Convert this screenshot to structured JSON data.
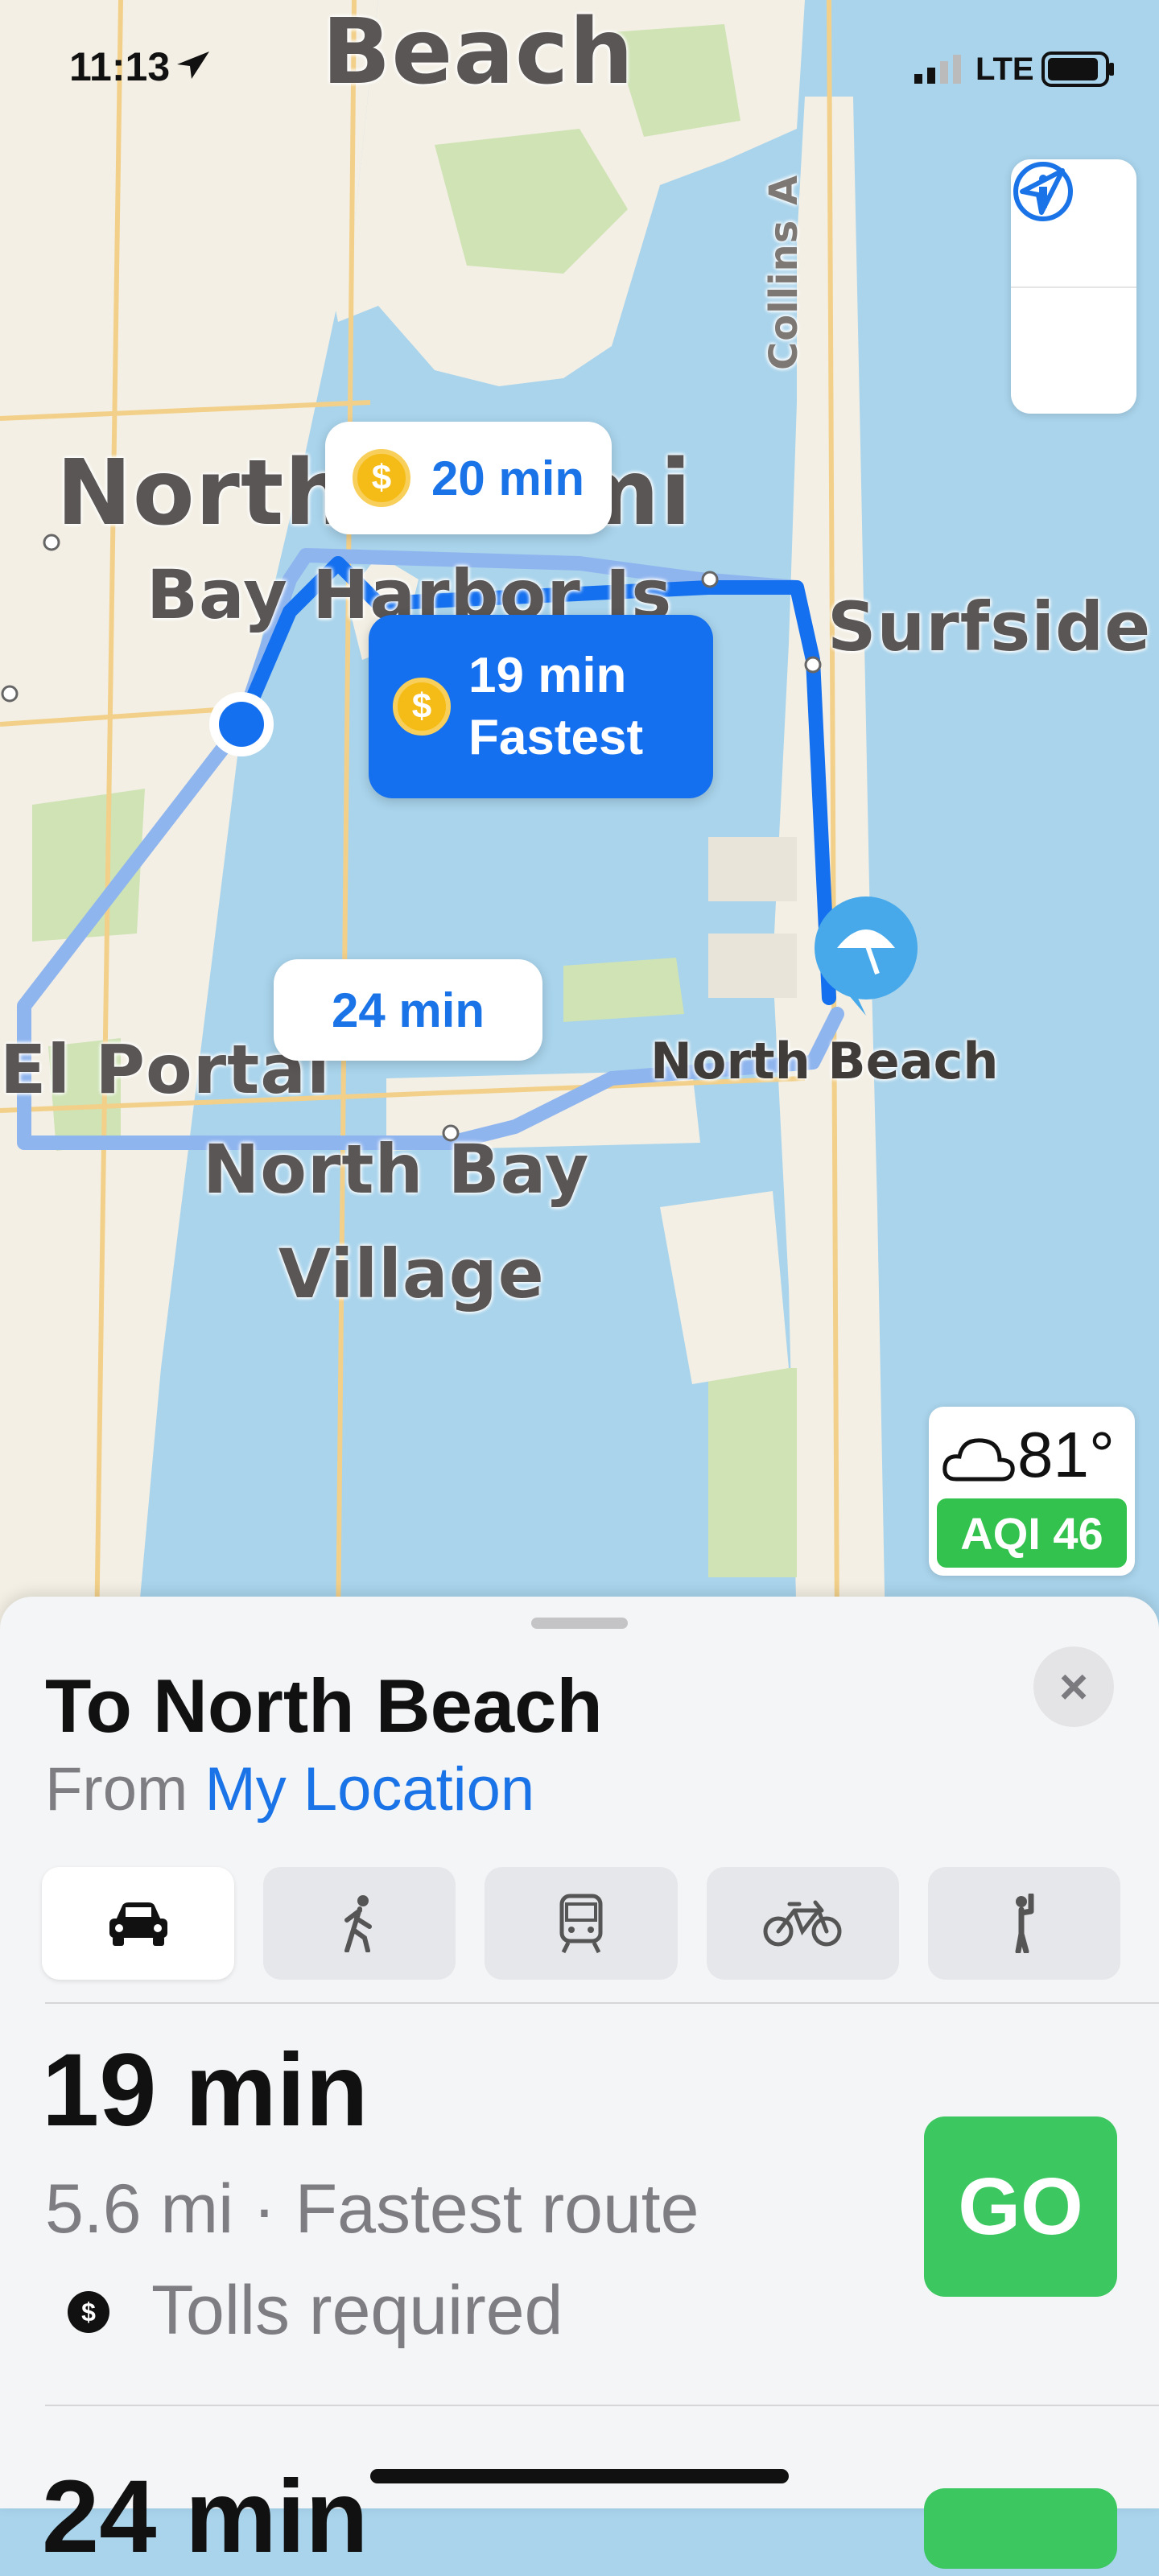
{
  "status_bar": {
    "time": "11:13",
    "network": "LTE"
  },
  "map": {
    "labels": {
      "beach_top": "Beach",
      "collins": "Collins A",
      "north_miami": "North Miami",
      "bay_harbor": "Bay Harbor Is",
      "surfside": "Surfside",
      "el_portal": "El Portal",
      "north_bay_village_1": "North Bay",
      "north_bay_village_2": "Village",
      "north_beach": "North Beach"
    },
    "routes": [
      {
        "time": "20 min",
        "toll": true
      },
      {
        "time": "19 min",
        "tag": "Fastest",
        "toll": true,
        "selected": true
      },
      {
        "time": "24 min",
        "toll": false
      }
    ],
    "toll_symbol": "$",
    "weather": {
      "temperature": "81°",
      "aqi": "AQI 46"
    }
  },
  "sheet": {
    "title": "To North Beach",
    "from_prefix": "From",
    "from_location": "My Location",
    "close_label": "×",
    "modes": [
      "car",
      "walk",
      "transit",
      "cycle",
      "ride-share"
    ],
    "selected_mode": "car",
    "route": {
      "time": "19 min",
      "detail": "5.6 mi · Fastest route",
      "tolls": "Tolls required",
      "go_label": "GO"
    },
    "next_route_peek": "24 min"
  },
  "colors": {
    "water": "#a9d4ec",
    "land": "#f3efe4",
    "park": "#cfe3b5",
    "route_primary": "#1570ef",
    "route_alt": "#8fb5ef",
    "go_green": "#3cc760",
    "link_blue": "#1a74e8"
  }
}
